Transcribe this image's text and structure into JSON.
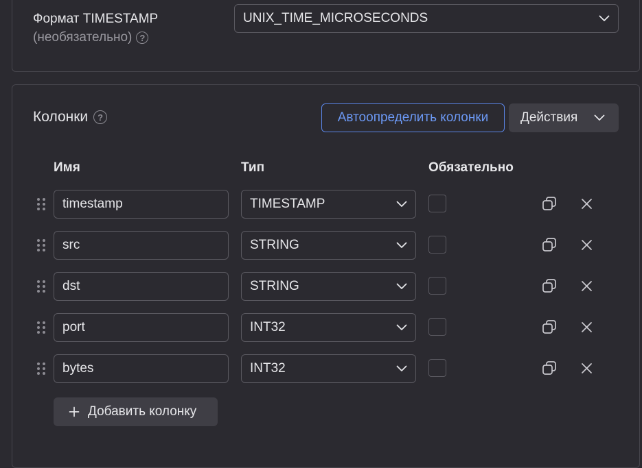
{
  "timestamp_format": {
    "label": "Формат TIMESTAMP",
    "optional": "(необязательно)",
    "value": "UNIX_TIME_MICROSECONDS"
  },
  "columns": {
    "title": "Колонки",
    "autodetect_label": "Автоопределить колонки",
    "actions_label": "Действия",
    "headers": {
      "name": "Имя",
      "type": "Тип",
      "required": "Обязательно"
    },
    "rows": [
      {
        "name": "timestamp",
        "type": "TIMESTAMP",
        "required": false
      },
      {
        "name": "src",
        "type": "STRING",
        "required": false
      },
      {
        "name": "dst",
        "type": "STRING",
        "required": false
      },
      {
        "name": "port",
        "type": "INT32",
        "required": false
      },
      {
        "name": "bytes",
        "type": "INT32",
        "required": false
      }
    ],
    "add_label": "Добавить колонку"
  },
  "icons": {
    "help": "help-circle-icon",
    "chevron": "chevron-down-icon",
    "drag": "drag-handle-icon",
    "copy": "copy-icon",
    "close": "close-icon",
    "plus": "plus-icon"
  },
  "colors": {
    "background": "#2b2a30",
    "accent": "#6c99f5",
    "border": "#5a5960",
    "button_bg": "#3f3e45"
  }
}
